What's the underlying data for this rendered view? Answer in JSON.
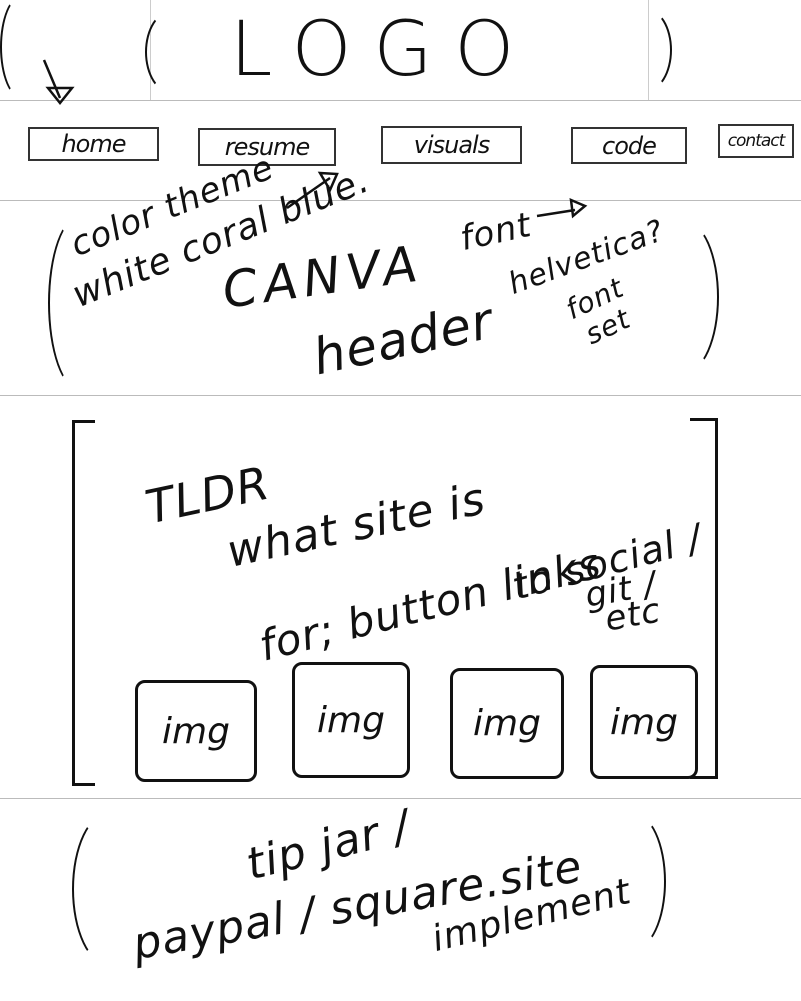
{
  "header": {
    "logo": "LOGO"
  },
  "nav": {
    "items": [
      {
        "label": "home"
      },
      {
        "label": "resume"
      },
      {
        "label": "visuals"
      },
      {
        "label": "code"
      },
      {
        "label": "contact"
      }
    ]
  },
  "style_notes": {
    "color_theme": "color theme",
    "colors": "white coral blue.",
    "canva": "CANVA",
    "font": "font",
    "helvetica": "helvetica?",
    "header": "header",
    "font_set": "font",
    "font_set2": "set"
  },
  "tldr": {
    "title": "TLDR",
    "line1": "what site is",
    "line2": "for; button links",
    "line3": "to social /",
    "line4": "git /",
    "line5": "etc",
    "images": [
      "img",
      "img",
      "img",
      "img"
    ]
  },
  "tip_jar": {
    "line1": "tip jar /",
    "line2": "paypal / square.site",
    "line3": "implement"
  }
}
